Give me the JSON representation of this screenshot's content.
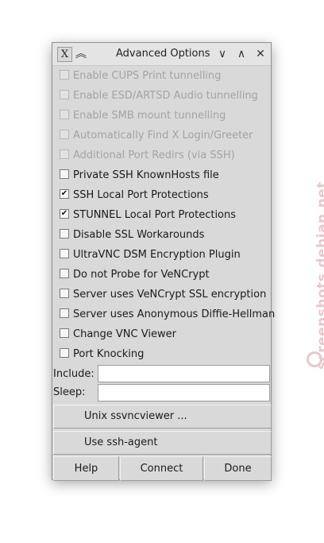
{
  "window": {
    "title": "Advanced Options",
    "app_icon_glyph": "X",
    "controls": [
      "∨",
      "∧",
      "✕"
    ]
  },
  "options": [
    {
      "label": "Enable CUPS Print tunnelling",
      "checked": false,
      "disabled": true
    },
    {
      "label": "Enable ESD/ARTSD Audio tunnelling",
      "checked": false,
      "disabled": true
    },
    {
      "label": "Enable SMB mount tunnelling",
      "checked": false,
      "disabled": true
    },
    {
      "label": "Automatically Find X Login/Greeter",
      "checked": false,
      "disabled": true
    },
    {
      "label": "Additional Port Redirs (via SSH)",
      "checked": false,
      "disabled": true
    },
    {
      "label": "Private SSH KnownHosts file",
      "checked": false,
      "disabled": false
    },
    {
      "label": "SSH Local Port Protections",
      "checked": true,
      "disabled": false
    },
    {
      "label": "STUNNEL Local Port Protections",
      "checked": true,
      "disabled": false
    },
    {
      "label": "Disable SSL Workarounds",
      "checked": false,
      "disabled": false
    },
    {
      "label": "UltraVNC DSM Encryption Plugin",
      "checked": false,
      "disabled": false
    },
    {
      "label": "Do not Probe for VeNCrypt",
      "checked": false,
      "disabled": false
    },
    {
      "label": "Server uses VeNCrypt SSL encryption",
      "checked": false,
      "disabled": false
    },
    {
      "label": "Server uses Anonymous Diffie-Hellman",
      "checked": false,
      "disabled": false
    },
    {
      "label": "Change VNC Viewer",
      "checked": false,
      "disabled": false
    },
    {
      "label": "Port Knocking",
      "checked": false,
      "disabled": false
    }
  ],
  "fields": {
    "include_label": "Include:",
    "include_value": "",
    "sleep_label": "Sleep:",
    "sleep_value": ""
  },
  "buttons": {
    "unix_viewer": "Unix ssvncviewer ...",
    "ssh_agent": "Use ssh-agent",
    "help": "Help",
    "connect": "Connect",
    "done": "Done"
  },
  "watermark": "screenshots.debian.net",
  "colors": {
    "window_bg": "#d9d9d9",
    "disabled_text": "#a3a3a3",
    "watermark": "#e8c8cc"
  }
}
